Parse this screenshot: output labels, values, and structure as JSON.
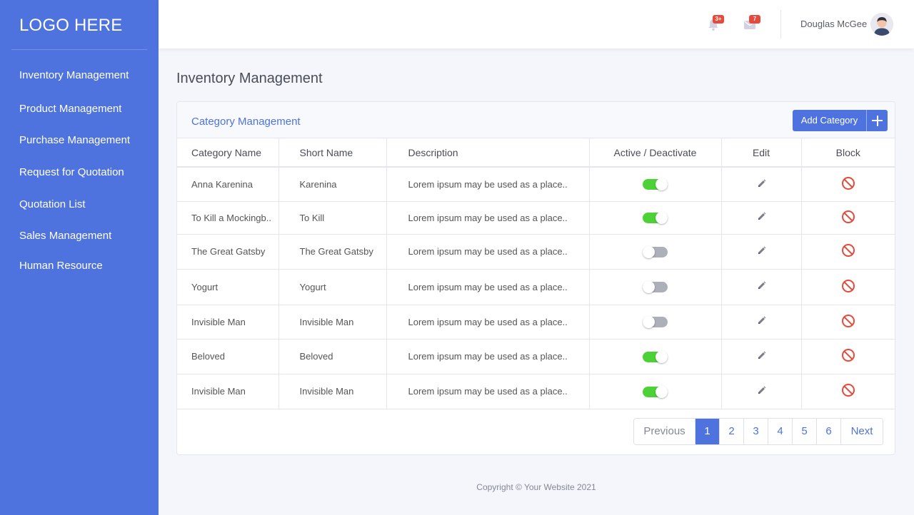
{
  "sidebar": {
    "logo": "LOGO HERE",
    "items": [
      {
        "label": "Inventory Management"
      },
      {
        "label": "Product Management"
      },
      {
        "label": "Purchase Management"
      },
      {
        "label": "Request for Quotation"
      },
      {
        "label": "Quotation List"
      },
      {
        "label": "Sales Management"
      },
      {
        "label": "Human Resource"
      }
    ]
  },
  "topbar": {
    "notifications_badge": "3+",
    "messages_badge": "7",
    "user_name": "Douglas McGee"
  },
  "page": {
    "title": "Inventory Management"
  },
  "card": {
    "title": "Category Management",
    "add_button_label": "Add Category"
  },
  "table": {
    "headers": [
      "Category Name",
      "Short Name",
      "Description",
      "Active / Deactivate",
      "Edit",
      "Block"
    ],
    "rows": [
      {
        "name": "Anna Karenina",
        "short": "Karenina",
        "description": "Lorem ipsum may be used as a place..",
        "active": true
      },
      {
        "name": "To Kill a Mockingb..",
        "short": "To Kill",
        "description": "Lorem ipsum may be used as a place..",
        "active": true
      },
      {
        "name": "The Great Gatsby",
        "short": "The Great Gatsby",
        "description": "Lorem ipsum may be used as a place..",
        "active": false
      },
      {
        "name": "Yogurt",
        "short": "Yogurt",
        "description": "Lorem ipsum may be used as a place..",
        "active": false
      },
      {
        "name": "Invisible Man",
        "short": "Invisible Man",
        "description": "Lorem ipsum may be used as a place..",
        "active": false
      },
      {
        "name": "Beloved",
        "short": "Beloved",
        "description": "Lorem ipsum may be used as a place..",
        "active": true
      },
      {
        "name": "Invisible Man",
        "short": "Invisible Man",
        "description": "Lorem ipsum may be used as a place..",
        "active": true
      }
    ]
  },
  "pagination": {
    "previous_label": "Previous",
    "pages": [
      "1",
      "2",
      "3",
      "4",
      "5",
      "6"
    ],
    "active_page": "1",
    "next_label": "Next"
  },
  "footer": {
    "copyright": "Copyright © Your Website 2021"
  },
  "colors": {
    "primary": "#4e73df",
    "toggle_on": "#4cd137",
    "toggle_off": "#adb0b8",
    "block_icon": "#e74a3b",
    "badge": "#e74a3b"
  },
  "icons": {
    "notifications": "bell-icon",
    "messages": "envelope-icon",
    "edit": "pencil-icon",
    "block": "block-icon",
    "add": "plus-icon"
  }
}
